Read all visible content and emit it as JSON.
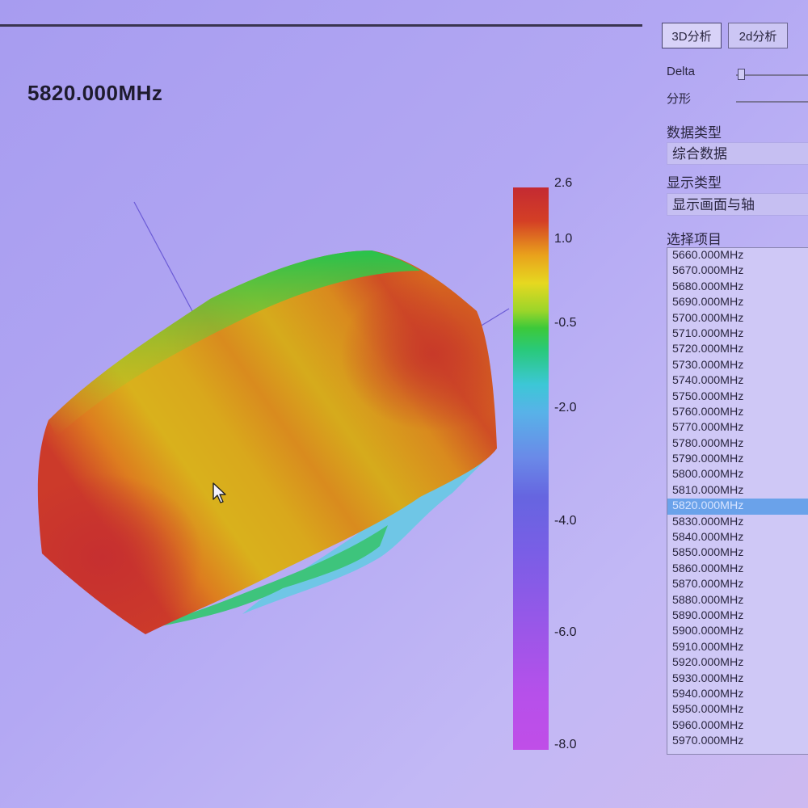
{
  "plot": {
    "frequency_label": "5820.000MHz",
    "colorbar_ticks": [
      "2.6",
      "1.0",
      "-0.5",
      "-2.0",
      "-4.0",
      "-6.0",
      "-8.0"
    ]
  },
  "panel": {
    "tabs": [
      {
        "label": "3D分析",
        "active": true
      },
      {
        "label": "2d分析",
        "active": false
      }
    ],
    "delta_label": "Delta",
    "fractal_label": "分形",
    "data_type_label": "数据类型",
    "data_type_value": "综合数据",
    "display_type_label": "显示类型",
    "display_type_value": "显示画面与轴",
    "select_item_label": "选择项目",
    "items": [
      "5660.000MHz",
      "5670.000MHz",
      "5680.000MHz",
      "5690.000MHz",
      "5700.000MHz",
      "5710.000MHz",
      "5720.000MHz",
      "5730.000MHz",
      "5740.000MHz",
      "5750.000MHz",
      "5760.000MHz",
      "5770.000MHz",
      "5780.000MHz",
      "5790.000MHz",
      "5800.000MHz",
      "5810.000MHz",
      "5820.000MHz",
      "5830.000MHz",
      "5840.000MHz",
      "5850.000MHz",
      "5860.000MHz",
      "5870.000MHz",
      "5880.000MHz",
      "5890.000MHz",
      "5900.000MHz",
      "5910.000MHz",
      "5920.000MHz",
      "5930.000MHz",
      "5940.000MHz",
      "5950.000MHz",
      "5960.000MHz",
      "5970.000MHz"
    ],
    "selected_item": "5820.000MHz"
  },
  "colors": {
    "selection": "#6aa2ea",
    "hot": "#c42a32",
    "cold": "#c04ee8"
  }
}
